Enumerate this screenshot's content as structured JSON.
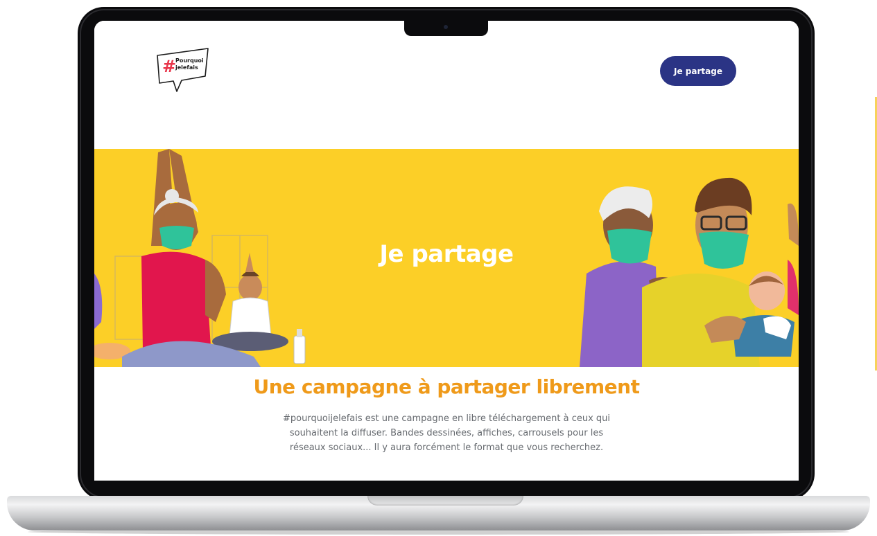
{
  "header": {
    "logo_text_1": "Pourquoi",
    "logo_text_2": "jelefais",
    "logo_hash": "#",
    "share_button_label": "Je partage"
  },
  "hero": {
    "title": "Je partage",
    "background_color": "#fccf27"
  },
  "intro": {
    "title": "Une campagne à partager librement",
    "text": "#pourquoijelefais est une campagne en libre téléchargement à ceux qui souhaitent la diffuser. Bandes dessinées, affiches, carrousels pour les réseaux sociaux... Il y aura forcément le format que vous recherchez."
  },
  "colors": {
    "accent_blue": "#2b3485",
    "accent_orange": "#ef9a1a",
    "hero_yellow": "#fccf27"
  }
}
